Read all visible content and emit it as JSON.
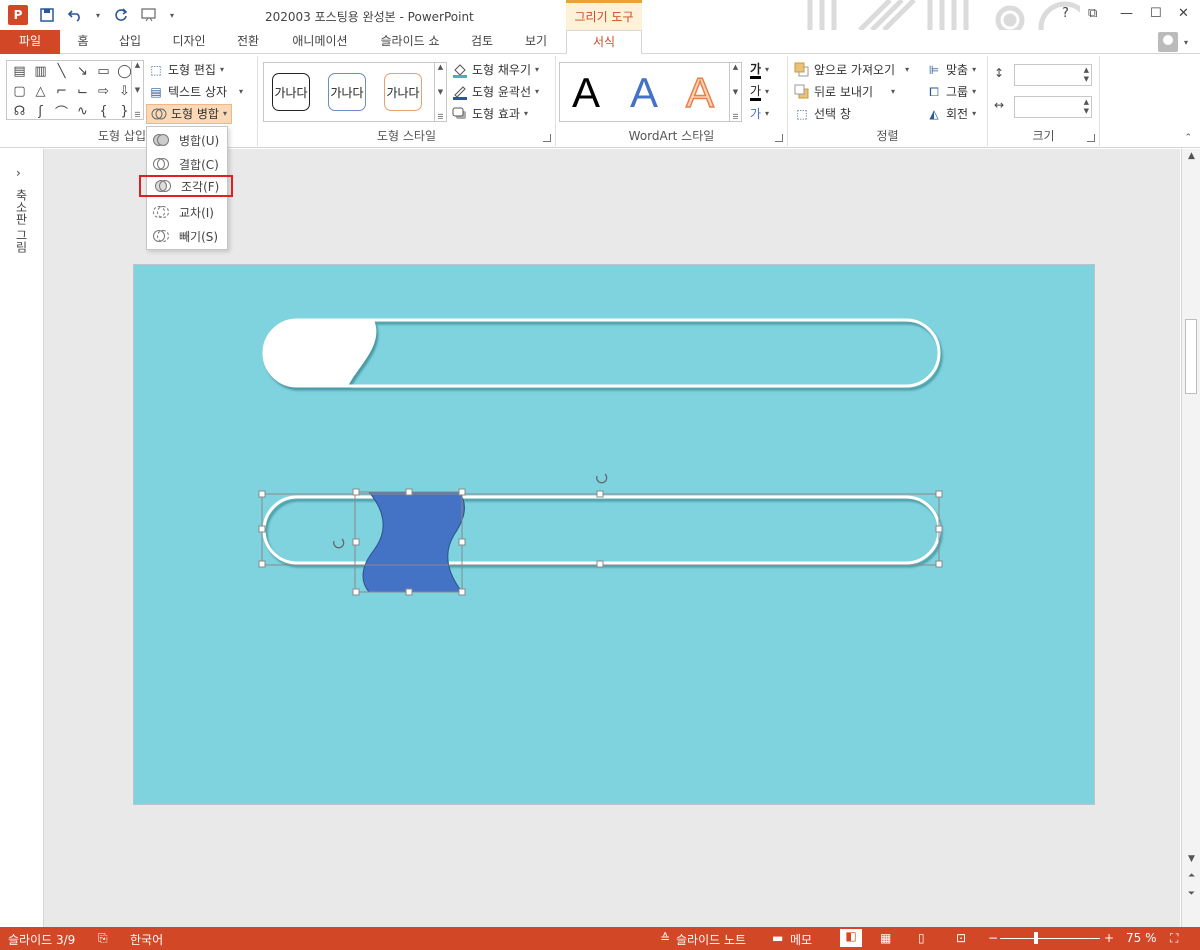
{
  "app": {
    "doc_title": "202003 포스팅용 완성본 - PowerPoint",
    "context_tab_group": "그리기 도구",
    "logo": "P"
  },
  "window_controls": {
    "help": "?",
    "restore_ribbon": "⧉",
    "minimize": "—",
    "maximize": "☐",
    "close": "✕"
  },
  "tabs": [
    "파일",
    "홈",
    "삽입",
    "디자인",
    "전환",
    "애니메이션",
    "슬라이드 쇼",
    "검토",
    "보기",
    "서식"
  ],
  "ribbon": {
    "insert_shapes": {
      "label": "도형 삽입",
      "edit_shape": "도형 편집",
      "text_box": "텍스트 상자",
      "merge_shapes": "도형 병합"
    },
    "shape_styles": {
      "label": "도형 스타일",
      "sample": "가나다",
      "fill": "도형 채우기",
      "outline": "도형 윤곽선",
      "effects": "도형 효과"
    },
    "wordart": {
      "label": "WordArt 스타일",
      "letter": "A",
      "text_fill_glyph": "가",
      "text_outline_glyph": "가",
      "text_effects_glyph": "가"
    },
    "arrange": {
      "label": "정렬",
      "bring_forward": "앞으로 가져오기",
      "send_backward": "뒤로 보내기",
      "selection_pane": "선택 창",
      "align": "맞춤",
      "group": "그룹",
      "rotate": "회전"
    },
    "size": {
      "label": "크기",
      "height": "",
      "width": ""
    }
  },
  "merge_menu": {
    "items": [
      {
        "label": "병합(U)",
        "icon": "union-icon"
      },
      {
        "label": "결합(C)",
        "icon": "combine-icon"
      },
      {
        "label": "조각(F)",
        "icon": "fragment-icon"
      },
      {
        "label": "교차(I)",
        "icon": "intersect-icon"
      },
      {
        "label": "빼기(S)",
        "icon": "subtract-icon"
      }
    ],
    "highlighted_index": 2
  },
  "left_pane": {
    "label": "축소판 그림",
    "chevron": "›"
  },
  "slide": {
    "background": "#7ed3df",
    "shape_fill": "#4472c4"
  },
  "statusbar": {
    "slide_counter": "슬라이드 3/9",
    "language": "한국어",
    "notes": "슬라이드 노트",
    "comments": "메모",
    "zoom": "75 %"
  },
  "colors": {
    "accent": "#d24726",
    "context_tab": "#e8a33d",
    "highlight_border": "#e02020"
  }
}
